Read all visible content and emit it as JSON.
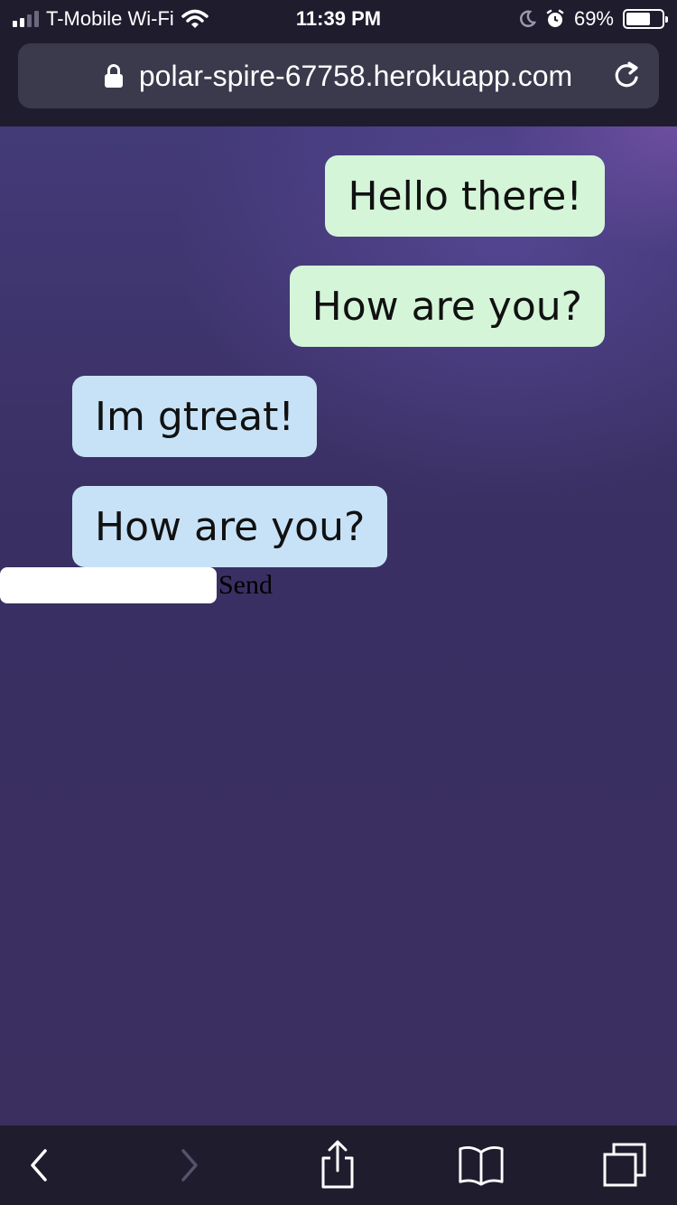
{
  "status_bar": {
    "carrier": "T-Mobile Wi-Fi",
    "time": "11:39 PM",
    "battery": "69%",
    "battery_level": 0.69
  },
  "browser": {
    "url": "polar-spire-67758.herokuapp.com"
  },
  "messages": [
    {
      "text": "Hello there!",
      "type": "sent"
    },
    {
      "text": "How are you?",
      "type": "sent"
    },
    {
      "text": "Im gtreat!",
      "type": "received"
    },
    {
      "text": "How are you?",
      "type": "received"
    }
  ],
  "compose": {
    "value": "",
    "send_label": "Send"
  },
  "colors": {
    "sent_bubble": "#d4f5d8",
    "received_bubble": "#c7e2f7",
    "background": "#3a2f5f",
    "chrome": "#1f1c2e"
  },
  "icons": {
    "back": "chevron-left-icon",
    "forward": "chevron-right-icon",
    "share": "share-icon",
    "bookmarks": "book-icon",
    "tabs": "tabs-icon"
  }
}
